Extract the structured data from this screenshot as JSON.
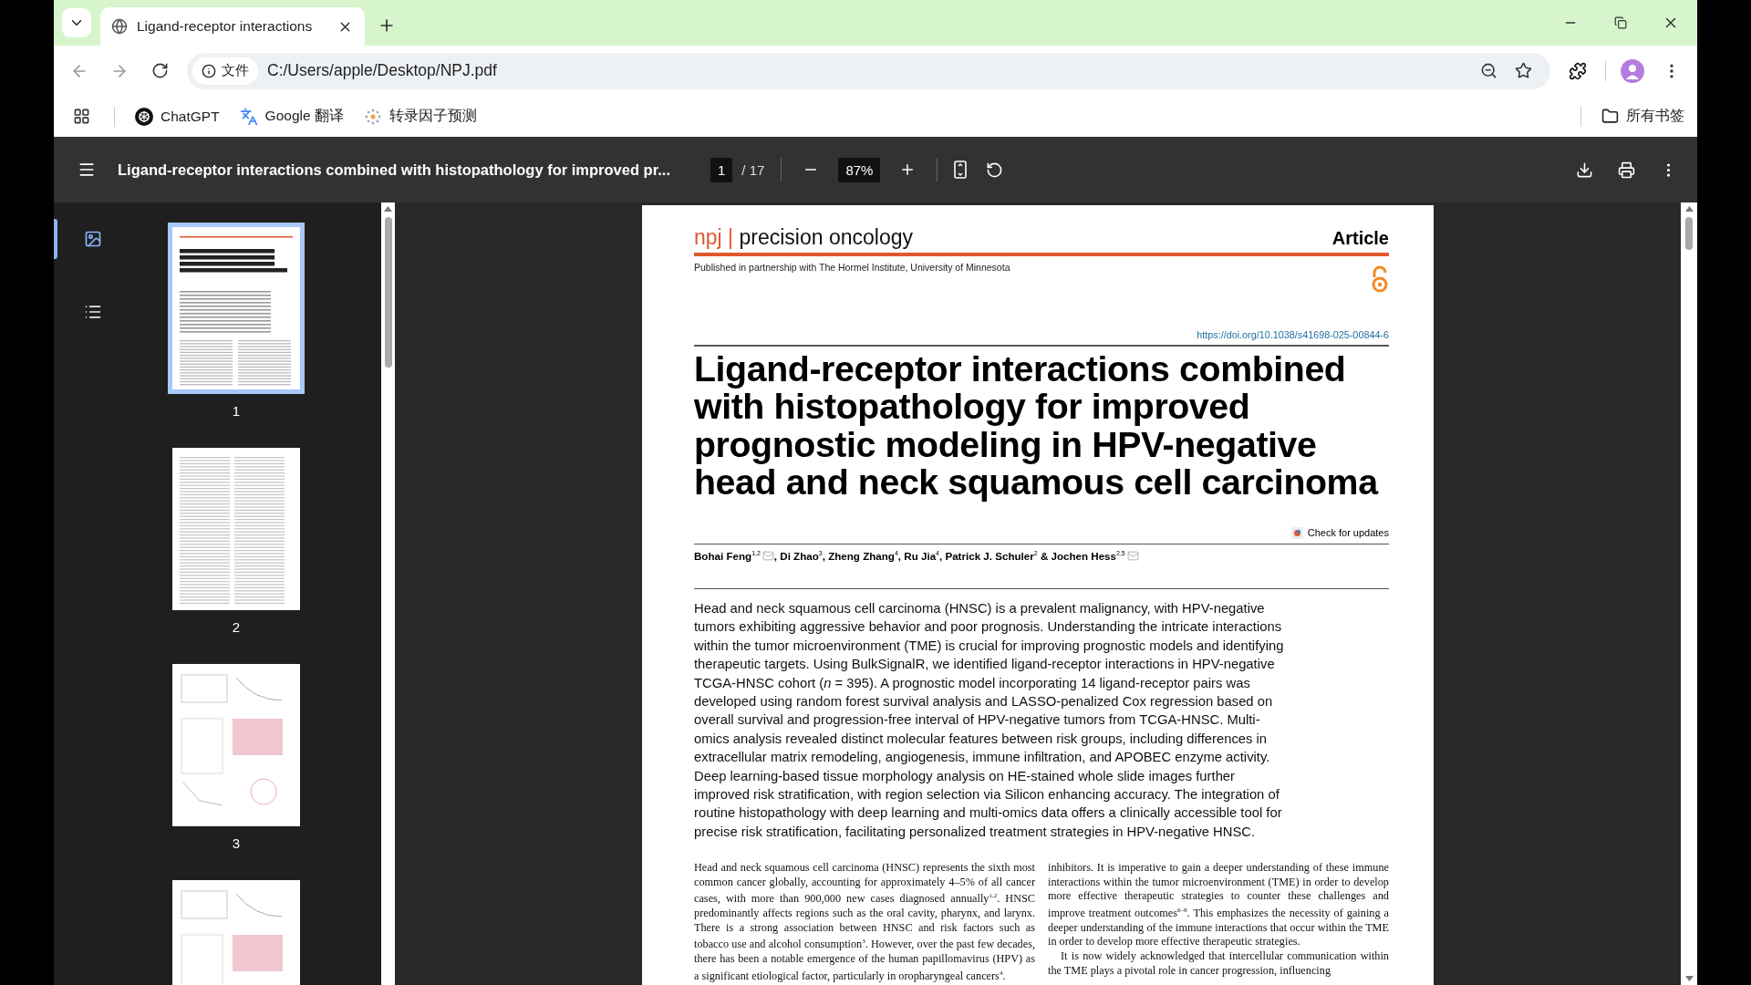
{
  "browser": {
    "tabs": [
      {
        "title": "Ligand-receptor interactions",
        "selected": true
      }
    ],
    "address": {
      "badge": "文件",
      "url": "C:/Users/apple/Desktop/NPJ.pdf"
    },
    "bookmarks": [
      {
        "label": "ChatGPT",
        "kind": "chatgpt"
      },
      {
        "label": "Google 翻译",
        "kind": "translate"
      },
      {
        "label": "转录因子预测",
        "kind": "sparkle"
      }
    ],
    "all_bookmarks": "所有书签"
  },
  "pdf_toolbar": {
    "title": "Ligand-receptor interactions combined with histopathology for improved pr...",
    "page": "1",
    "page_count": "/ 17",
    "zoom": "87%"
  },
  "sidebar": {
    "views": [
      {
        "kind": "thumbnails",
        "selected": true
      },
      {
        "kind": "outline",
        "selected": false
      }
    ],
    "thumbnails": [
      {
        "number": "1",
        "kind": "title",
        "selected": true
      },
      {
        "number": "2",
        "kind": "text",
        "selected": false
      },
      {
        "number": "3",
        "kind": "figure",
        "selected": false
      },
      {
        "kind": "figure",
        "selected": false
      }
    ]
  },
  "page": {
    "journal": {
      "brand": "npj",
      "separator": "|",
      "name": "precision oncology"
    },
    "article_type": "Article",
    "partnership": "Published in partnership with The Hormel Institute, University of Minnesota",
    "doi": "https://doi.org/10.1038/s41698-025-00844-6",
    "title": [
      "Ligand-receptor interactions combined",
      "with histopathology for improved",
      "prognostic modeling in HPV-negative",
      "head and neck squamous cell carcinoma"
    ],
    "check_updates": "Check for updates",
    "authors": [
      {
        "text": "Bohai Feng$^{1,2}$",
        "email": true
      },
      {
        "text": ", Di Zhao$^{3}$, Zheng Zhang$^{4}$, Ru Jia$^{4}$, Patrick J. Schuler$^{2}$ & Jochen Hess$^{2,5}$",
        "email": true
      }
    ],
    "abstract": "Head and neck squamous cell carcinoma (HNSC) is a prevalent malignancy, with HPV-negative tumors exhibiting aggressive behavior and poor prognosis. Understanding the intricate interactions within the tumor microenvironment (TME) is crucial for improving prognostic models and identifying therapeutic targets. Using BulkSignalR, we identified ligand-receptor interactions in HPV-negative TCGA-HNSC cohort (*n* = 395). A prognostic model incorporating 14 ligand-receptor pairs was developed using random forest survival analysis and LASSO-penalized Cox regression based on overall survival and progression-free interval of HPV-negative tumors from TCGA-HNSC. Multi-omics analysis revealed distinct molecular features between risk groups, including differences in extracellular matrix remodeling, angiogenesis, immune infiltration, and APOBEC enzyme activity. Deep learning-based tissue morphology analysis on HE-stained whole slide images further improved risk stratification, with region selection via Silicon enhancing accuracy. The integration of routine histopathology with deep learning and multi-omics data offers a clinically accessible tool for precise risk stratification, facilitating personalized treatment strategies in HPV-negative HNSC.",
    "columns": [
      [
        {
          "text": "Head and neck squamous cell carcinoma (HNSC) represents the sixth most common cancer globally, accounting for approximately 4–5% of all cancer cases, with more than 900,000 new cases diagnosed annually$^{1,2}$. HNSC predominantly affects regions such as the oral cavity, pharynx, and larynx. There is a strong association between HNSC and risk factors such as tobacco use and alcohol consumption$^{3}$. However, over the past few decades, there has been a notable emergence of the human papillomavirus (HPV) as a significant etiological factor, particularly in oropharyngeal cancers$^{4}$.",
          "indent": false
        }
      ],
      [
        {
          "text": "inhibitors. It is imperative to gain a deeper understanding of these immune interactions within the tumor microenvironment (TME) in order to develop more effective therapeutic strategies to counter these challenges and improve treatment outcomes$^{6–8}$. This emphasizes the necessity of gaining a deeper understanding of the immune interactions that occur within the TME in order to develop more effective therapeutic strategies.",
          "indent": false
        },
        {
          "text": "It is now widely acknowledged that intercellular communication within the TME plays a pivotal role in cancer progression, influencing",
          "indent": true
        }
      ]
    ]
  }
}
